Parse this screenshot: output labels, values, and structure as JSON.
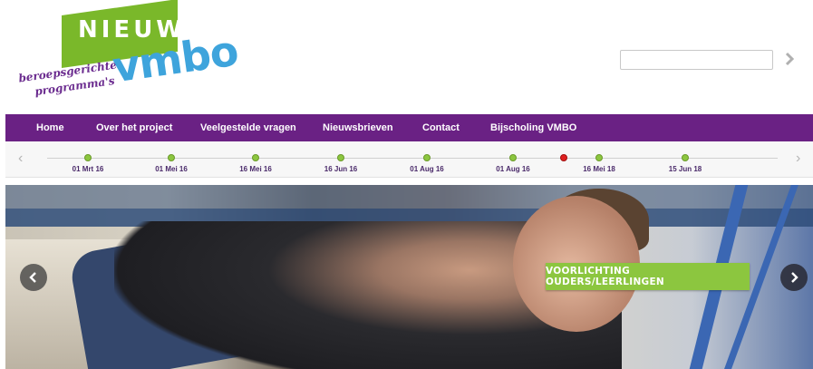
{
  "logo": {
    "badge": "NIEUW",
    "tagline_line1": "beroepsgerichte",
    "tagline_line2": "programma's",
    "wordmark": "vmbo",
    "colors": {
      "badge": "#7ab82a",
      "wordmark": "#3ea4dc",
      "tagline": "#6b2c8f"
    }
  },
  "search": {
    "value": "",
    "placeholder": "",
    "go_icon": "arrow-right-icon"
  },
  "nav": {
    "background": "#6a2184",
    "items": [
      {
        "label": "Home"
      },
      {
        "label": "Over het project"
      },
      {
        "label": "Veelgestelde vragen"
      },
      {
        "label": "Nieuwsbrieven"
      },
      {
        "label": "Contact"
      },
      {
        "label": "Bijscholing VMBO"
      }
    ]
  },
  "timeline": {
    "prev_icon": "chevron-left-icon",
    "next_icon": "chevron-right-icon",
    "events": [
      {
        "date": "01 Mrt 16"
      },
      {
        "date": "01 Mei 16"
      },
      {
        "date": "16 Mei 16"
      },
      {
        "date": "16 Jun 16"
      },
      {
        "date": "01 Aug 16"
      },
      {
        "date": "01 Aug 16"
      },
      {
        "date": "",
        "current": true
      },
      {
        "date": "16 Mei 18"
      },
      {
        "date": "15 Jun 18"
      }
    ]
  },
  "hero": {
    "cta_label": "VOORLICHTING OUDERS/LEERLINGEN",
    "cta_color": "#8cc63f",
    "prev_icon": "arrow-left-icon",
    "next_icon": "arrow-right-icon"
  }
}
